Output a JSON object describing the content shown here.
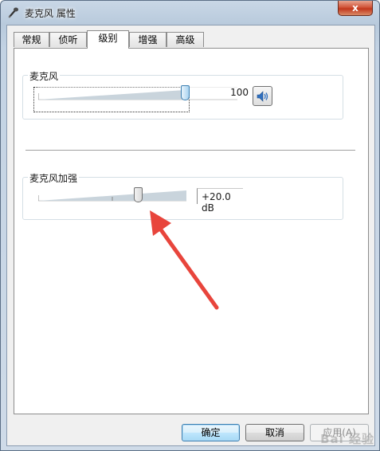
{
  "window": {
    "title": "麦克风 属性",
    "close_label": "x"
  },
  "tabs": [
    {
      "label": "常规",
      "active": false
    },
    {
      "label": "侦听",
      "active": false
    },
    {
      "label": "级别",
      "active": true
    },
    {
      "label": "增强",
      "active": false
    },
    {
      "label": "高级",
      "active": false
    }
  ],
  "microphone": {
    "label": "麦克风",
    "value": "100",
    "level": 100
  },
  "boost": {
    "label": "麦克风加强",
    "value": "+20.0 dB",
    "level_fraction": 0.67
  },
  "buttons": {
    "ok": "确定",
    "cancel": "取消",
    "apply": "应用",
    "apply_key": "(A)"
  },
  "watermark": "Bai 经验",
  "colors": {
    "arrow": "#e8453c",
    "accent": "#3c7fb1"
  },
  "icons": {
    "title": "microphone-icon",
    "speaker": "speaker-icon"
  }
}
